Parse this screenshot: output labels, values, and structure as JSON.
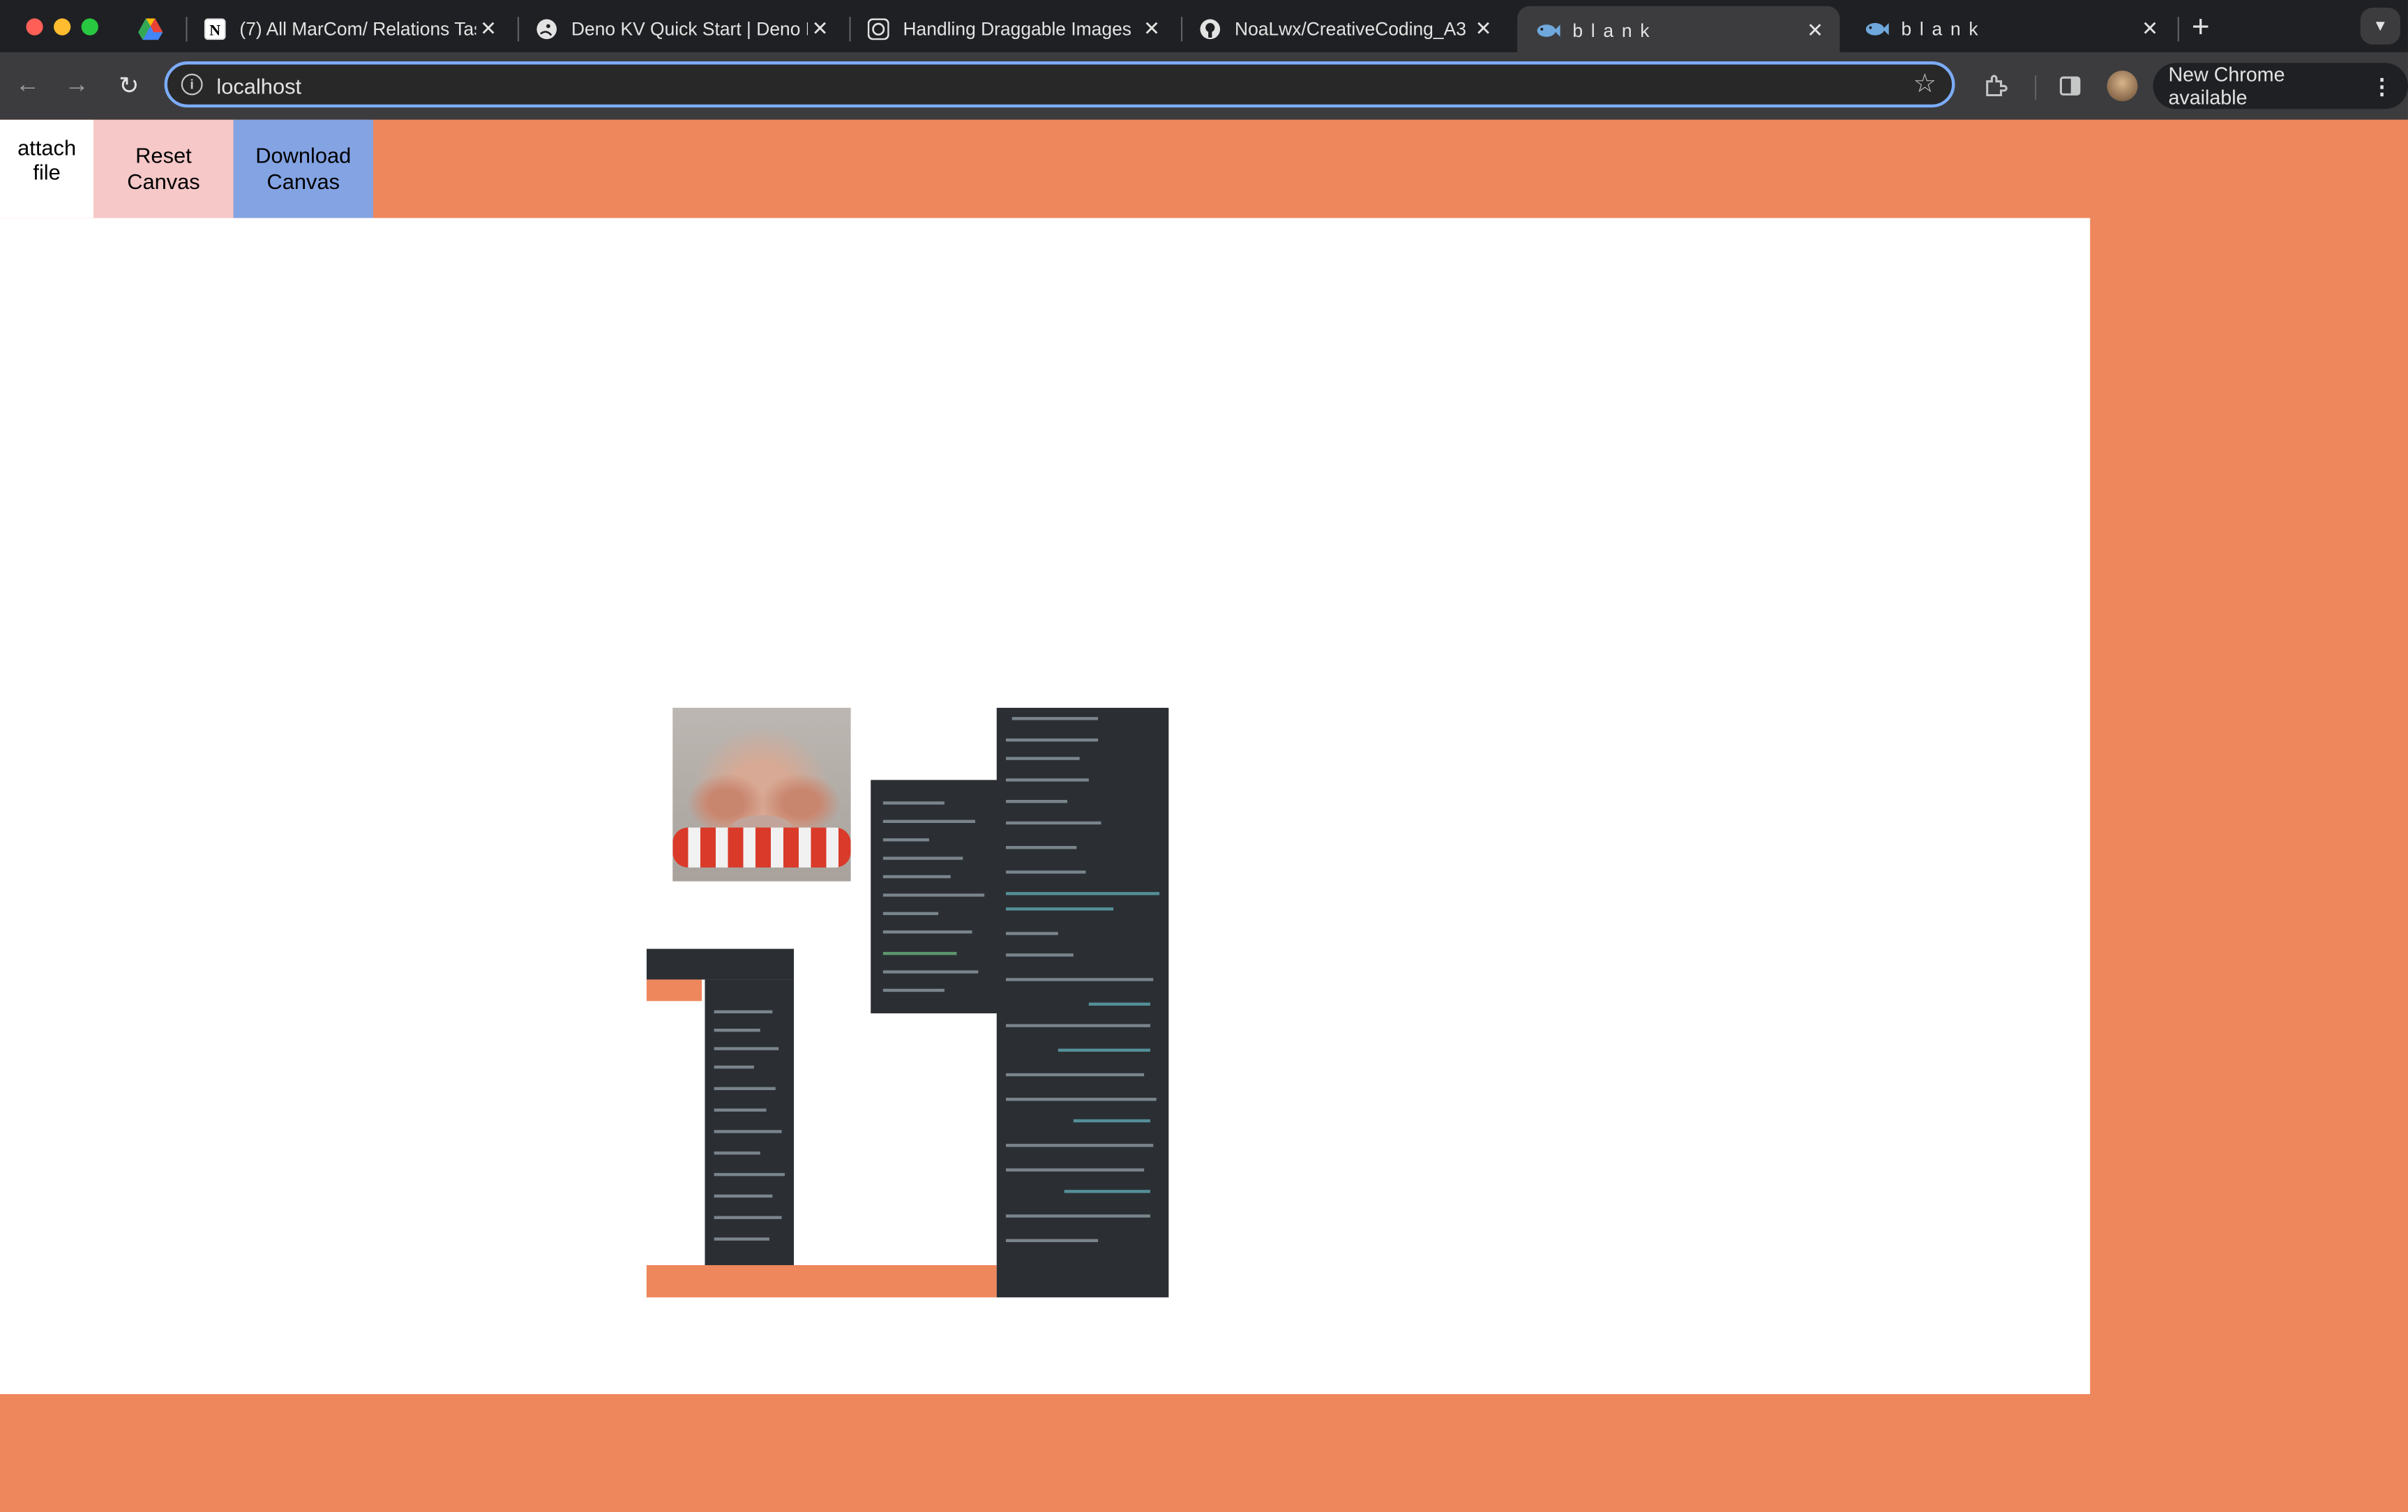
{
  "browser": {
    "tabs": [
      {
        "title": "",
        "favicon": "google-drive-icon",
        "active": false
      },
      {
        "title": "(7) All MarCom/ Relations Tas",
        "favicon": "notion-icon",
        "active": false
      },
      {
        "title": "Deno KV Quick Start | Deno D",
        "favicon": "deno-icon",
        "active": false
      },
      {
        "title": "Handling Draggable Images",
        "favicon": "chatgpt-icon",
        "active": false
      },
      {
        "title": "NoaLwx/CreativeCoding_A3",
        "favicon": "github-icon",
        "active": false
      },
      {
        "title": "b l a n k",
        "favicon": "fish-icon",
        "active": true
      },
      {
        "title": "b l a n k",
        "favicon": "fish-icon",
        "active": false
      }
    ],
    "address": "localhost",
    "update_label": "New Chrome available"
  },
  "page": {
    "attach_label": "attach\nfile",
    "reset_label": "Reset\nCanvas",
    "download_label": "Download\nCanvas"
  },
  "colors": {
    "page_background": "#ee875c",
    "canvas_background": "#ffffff",
    "reset_button": "#f6c8c8",
    "download_button": "#83a3e3",
    "omnibox_focus": "#7cacf8"
  }
}
